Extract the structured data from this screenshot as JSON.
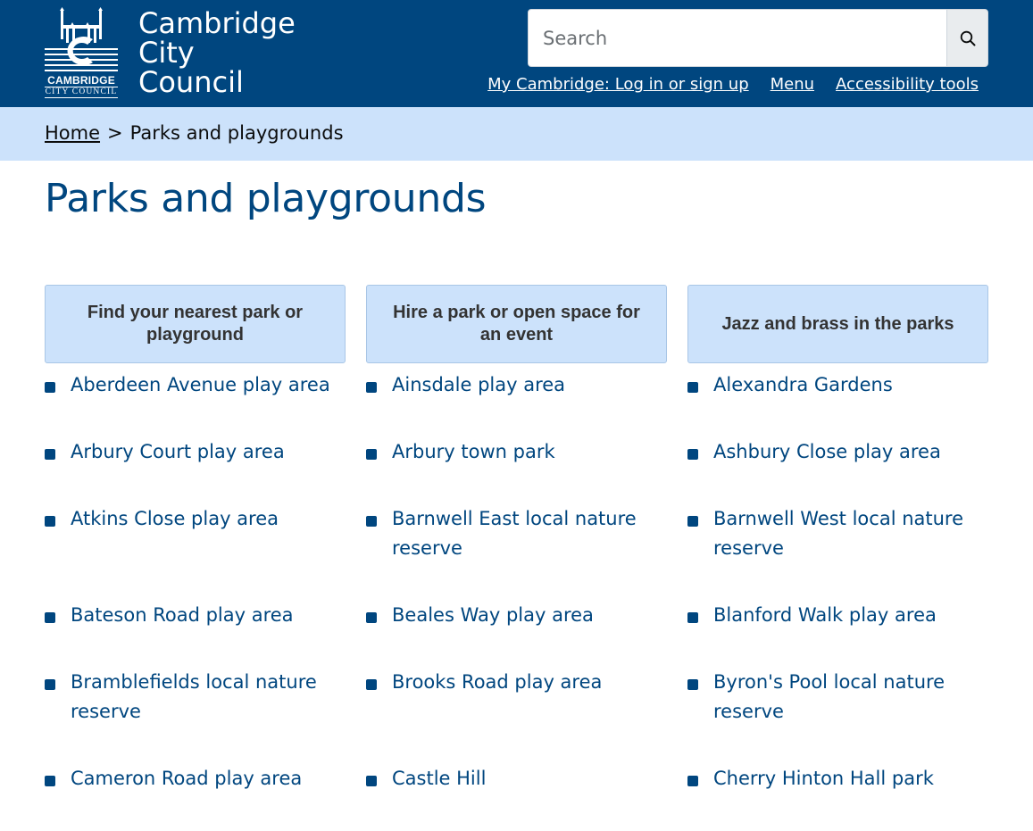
{
  "header": {
    "logo": {
      "line1": "CAMBRIDGE",
      "line2": "CITY COUNCIL"
    },
    "site_name": [
      "Cambridge",
      "City",
      "Council"
    ],
    "search_placeholder": "Search",
    "links": [
      "My Cambridge: Log in or sign up",
      "Menu",
      "Accessibility tools"
    ],
    "colors": {
      "header_bg": "#00467f",
      "breadcrumb_bg": "#cce2fb",
      "link": "#00467f"
    }
  },
  "breadcrumb": {
    "home": "Home",
    "separator": ">",
    "current": "Parks and playgrounds"
  },
  "page_title": "Parks and playgrounds",
  "cards": [
    "Find your nearest park or playground",
    "Hire a park or open space for an event",
    "Jazz and brass in the parks"
  ],
  "items": [
    "Aberdeen Avenue play area",
    "Ainsdale play area",
    "Alexandra Gardens",
    "Arbury Court play area",
    "Arbury town park",
    "Ashbury Close play area",
    "Atkins Close play area",
    "Barnwell East local nature reserve",
    "Barnwell West local nature reserve",
    "Bateson Road play area",
    "Beales Way play area",
    "Blanford Walk play area",
    "Bramblefields local nature reserve",
    "Brooks Road play area",
    "Byron's Pool local nature reserve",
    "Cameron Road play area",
    "Castle Hill",
    "Cherry Hinton Hall park"
  ]
}
